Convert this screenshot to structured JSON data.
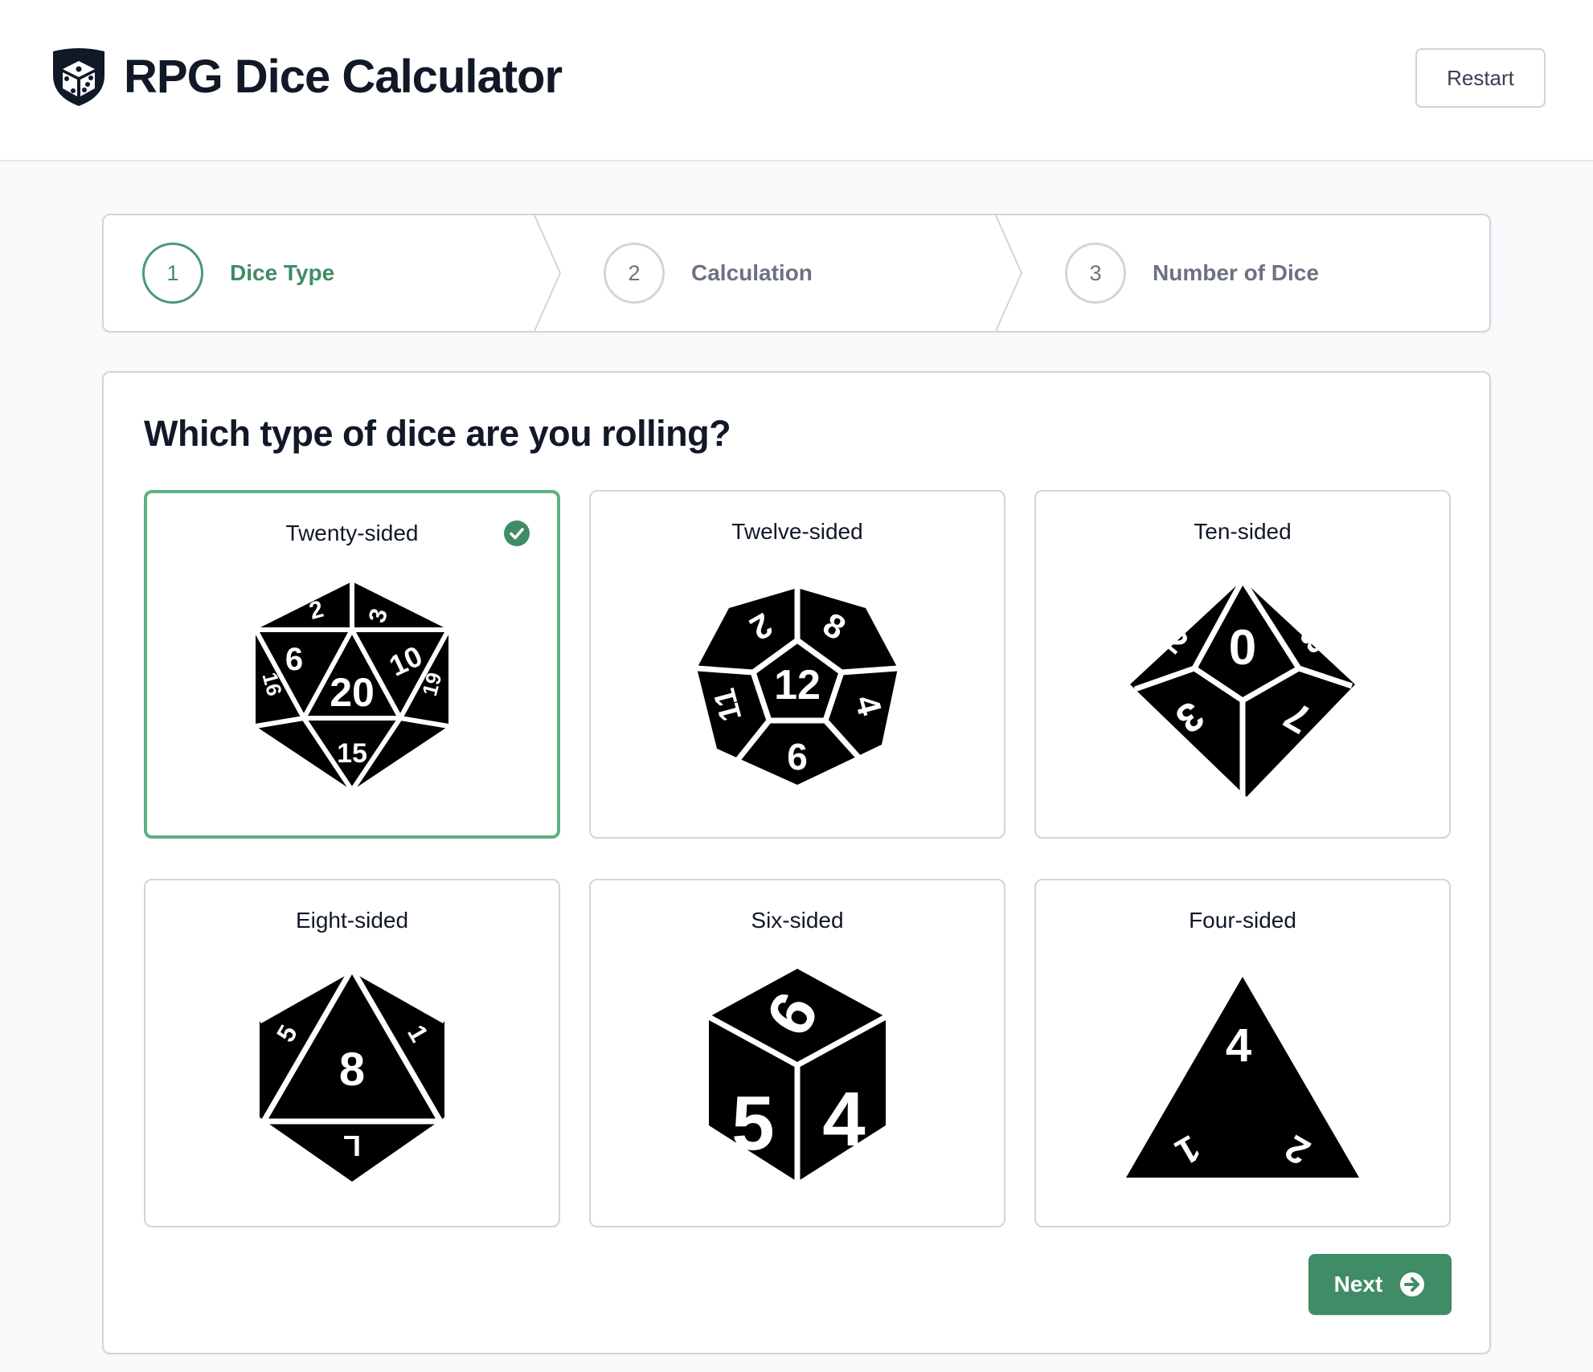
{
  "header": {
    "logo_icon": "dice-shield-icon",
    "title": "RPG Dice Calculator",
    "restart_label": "Restart"
  },
  "steps": [
    {
      "number": "1",
      "label": "Dice Type",
      "state": "current"
    },
    {
      "number": "2",
      "label": "Calculation",
      "state": "upcoming"
    },
    {
      "number": "3",
      "label": "Number of Dice",
      "state": "upcoming"
    }
  ],
  "main": {
    "question": "Which type of dice are you rolling?",
    "options": [
      {
        "label": "Twenty-sided",
        "icon": "d20-icon",
        "selected": true
      },
      {
        "label": "Twelve-sided",
        "icon": "d12-icon",
        "selected": false
      },
      {
        "label": "Ten-sided",
        "icon": "d10-icon",
        "selected": false
      },
      {
        "label": "Eight-sided",
        "icon": "d8-icon",
        "selected": false
      },
      {
        "label": "Six-sided",
        "icon": "d6-icon",
        "selected": false
      },
      {
        "label": "Four-sided",
        "icon": "d4-icon",
        "selected": false
      }
    ],
    "next_label": "Next"
  },
  "colors": {
    "accent": "#3f8c66",
    "selected_border": "#5bb086",
    "text_primary": "#111827",
    "text_muted": "#6b7280",
    "border": "#d1d5db"
  }
}
